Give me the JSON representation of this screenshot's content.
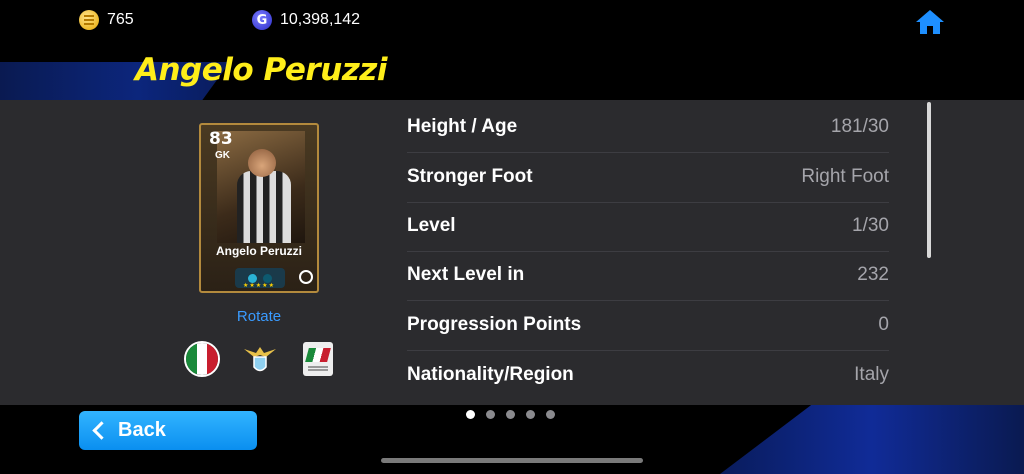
{
  "header": {
    "coins": "765",
    "gp": "10,398,142",
    "gp_icon_letter": "G",
    "player_name": "Angelo Peruzzi"
  },
  "card": {
    "rating": "83",
    "position": "GK",
    "name": "Angelo Peruzzi",
    "stars": "★★★★★",
    "rotate_label": "Rotate"
  },
  "stats": [
    {
      "label": "Height / Age",
      "value": "181/30"
    },
    {
      "label": "Stronger Foot",
      "value": "Right Foot"
    },
    {
      "label": "Level",
      "value": "1/30"
    },
    {
      "label": "Next Level in",
      "value": "232"
    },
    {
      "label": "Progression Points",
      "value": "0"
    },
    {
      "label": "Nationality/Region",
      "value": "Italy"
    }
  ],
  "pagination": {
    "pages": 5,
    "current": 1
  },
  "footer": {
    "back_label": "Back"
  },
  "colors": {
    "accent": "#0a8ff0",
    "title": "#ffee1a",
    "panel": "#2b2b2e"
  }
}
